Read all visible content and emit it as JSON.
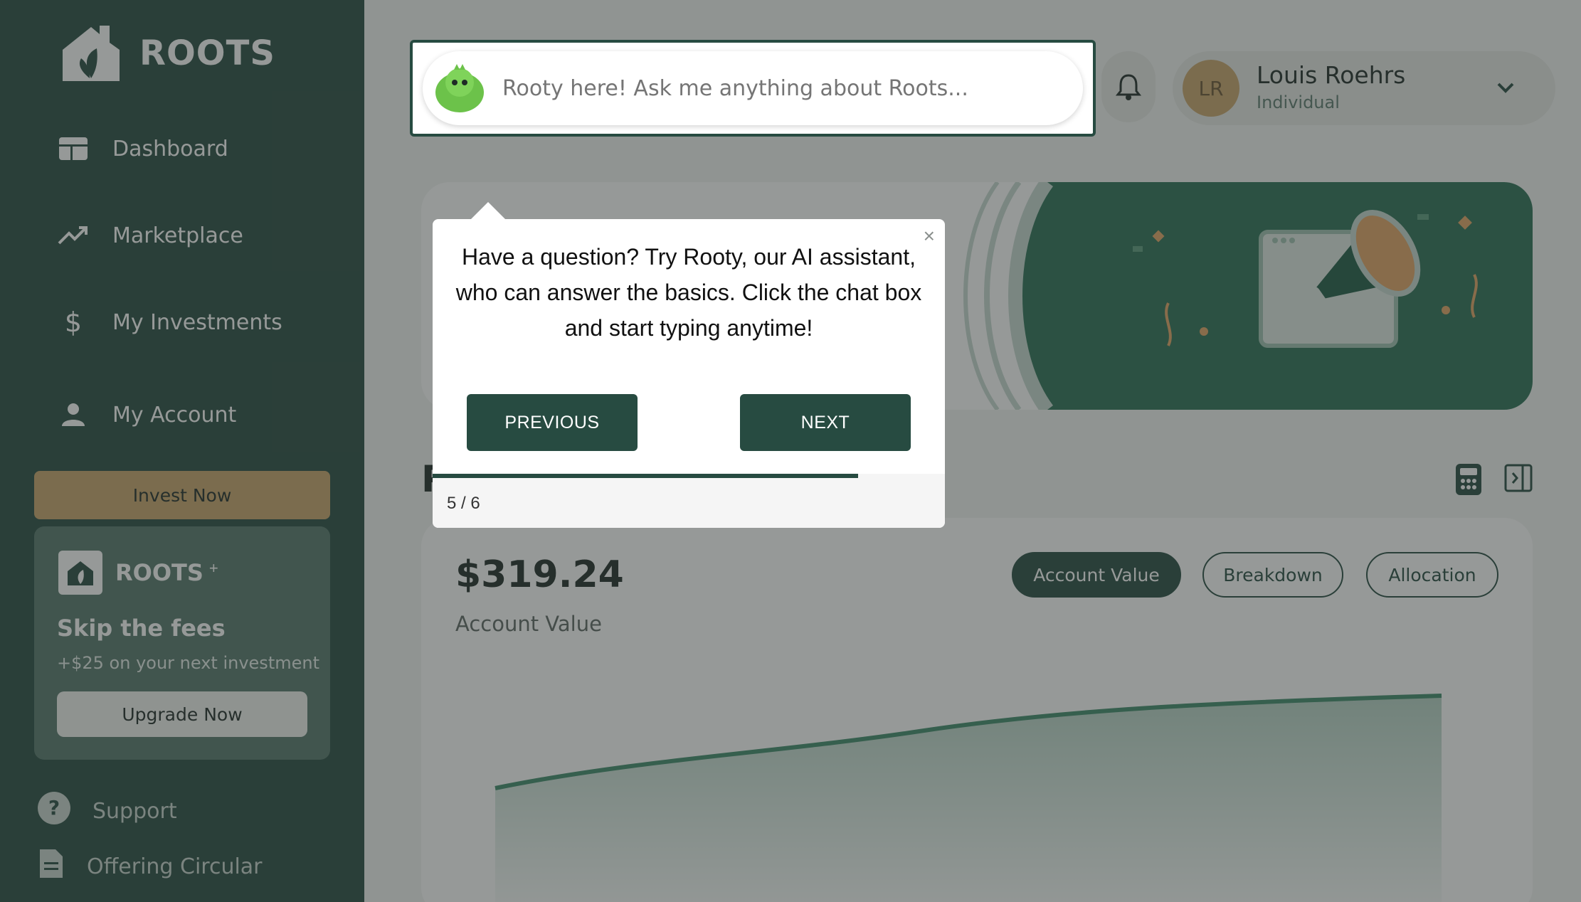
{
  "brand": {
    "name": "ROOTS"
  },
  "nav": [
    {
      "label": "Dashboard",
      "icon": "dashboard-icon"
    },
    {
      "label": "Marketplace",
      "icon": "trending-up-icon"
    },
    {
      "label": "My Investments",
      "icon": "dollar-icon"
    },
    {
      "label": "My Account",
      "icon": "person-icon"
    }
  ],
  "invest_button": "Invest Now",
  "promo": {
    "brand": "ROOTS",
    "plus": "+",
    "title": "Skip the fees",
    "subtitle": "+$25 on your next investment",
    "button": "Upgrade Now"
  },
  "bottom_links": [
    {
      "label": "Support",
      "icon": "help-icon"
    },
    {
      "label": "Offering Circular",
      "icon": "document-icon"
    }
  ],
  "chat": {
    "placeholder": "Rooty here! Ask me anything about Roots..."
  },
  "user": {
    "initials": "LR",
    "name": "Louis Roehrs",
    "role": "Individual"
  },
  "account": {
    "value": "$319.24",
    "value_label": "Account Value",
    "tabs": [
      "Account Value",
      "Breakdown",
      "Allocation"
    ],
    "active_tab": "Account Value"
  },
  "tour": {
    "message": "Have a question? Try Rooty, our AI assistant, who can answer the basics. Click the chat box and start typing anytime!",
    "previous": "PREVIOUS",
    "next": "NEXT",
    "step": "5 / 6",
    "close": "×",
    "progress": 0.83
  },
  "colors": {
    "primary": "#274b41",
    "accent": "#c9a56b"
  }
}
